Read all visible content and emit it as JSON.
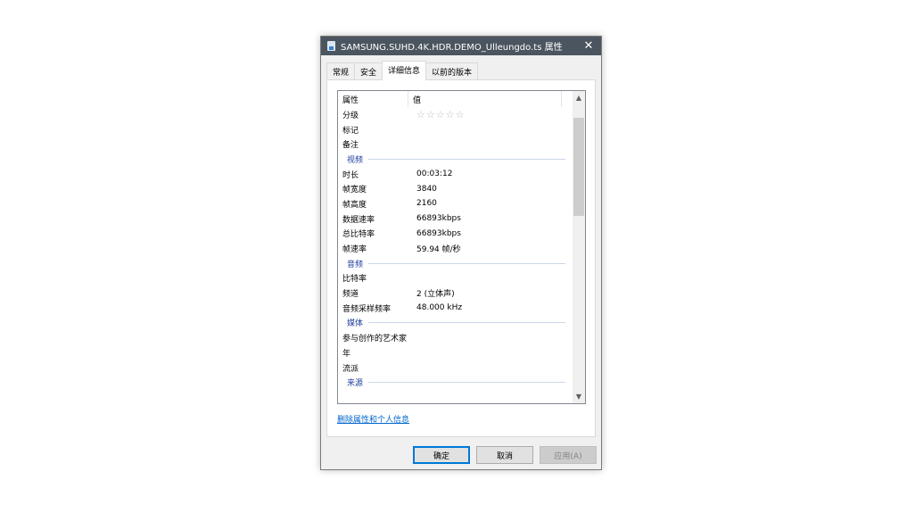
{
  "title": "SAMSUNG.SUHD.4K.HDR.DEMO_Ulleungdo.ts 属性",
  "tabs": [
    "常规",
    "安全",
    "详细信息",
    "以前的版本"
  ],
  "columns": {
    "property": "属性",
    "value": "值"
  },
  "rating": {
    "label": "分级",
    "stars": 0,
    "max": 5
  },
  "top_rows": [
    {
      "k": "标记",
      "v": ""
    },
    {
      "k": "备注",
      "v": ""
    }
  ],
  "video": {
    "label": "视频",
    "rows": [
      {
        "k": "时长",
        "v": "00:03:12"
      },
      {
        "k": "帧宽度",
        "v": "3840"
      },
      {
        "k": "帧高度",
        "v": "2160"
      },
      {
        "k": "数据速率",
        "v": "66893kbps"
      },
      {
        "k": "总比特率",
        "v": "66893kbps"
      },
      {
        "k": "帧速率",
        "v": "59.94 帧/秒"
      }
    ]
  },
  "audio": {
    "label": "音频",
    "rows": [
      {
        "k": "比特率",
        "v": ""
      },
      {
        "k": "频道",
        "v": "2 (立体声)"
      },
      {
        "k": "音频采样频率",
        "v": "48.000 kHz"
      }
    ]
  },
  "media": {
    "label": "媒体",
    "rows": [
      {
        "k": "参与创作的艺术家",
        "v": ""
      },
      {
        "k": "年",
        "v": ""
      },
      {
        "k": "流派",
        "v": ""
      }
    ]
  },
  "origin": {
    "label": "来源"
  },
  "remove_link": "删除属性和个人信息",
  "buttons": {
    "ok": "确定",
    "cancel": "取消",
    "apply": "应用(A)"
  }
}
